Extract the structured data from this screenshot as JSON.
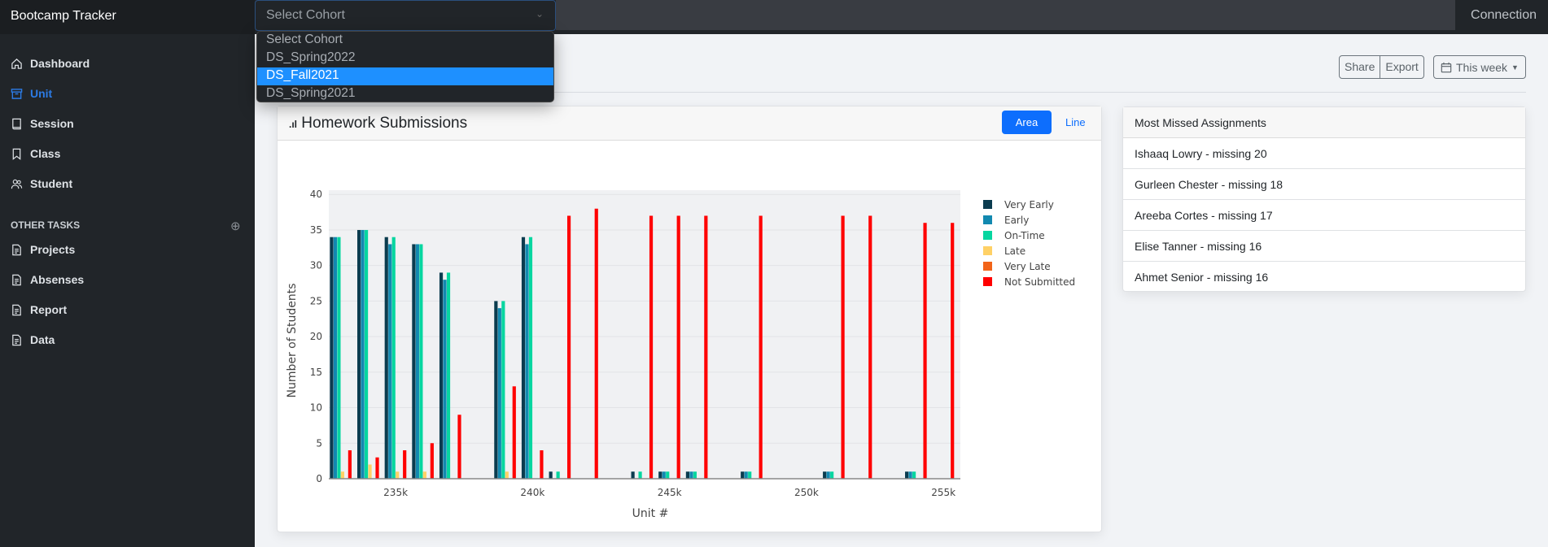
{
  "app": {
    "title": "Bootcamp Tracker",
    "connection_label": "Connection"
  },
  "cohort_select": {
    "value": "Select Cohort",
    "options": [
      "Select Cohort",
      "DS_Spring2022",
      "DS_Fall2021",
      "DS_Spring2021"
    ],
    "highlighted": "DS_Fall2021"
  },
  "sidebar": {
    "items": [
      {
        "label": "Dashboard",
        "icon": "house-icon"
      },
      {
        "label": "Unit",
        "icon": "archive-icon",
        "active": true
      },
      {
        "label": "Session",
        "icon": "book-icon"
      },
      {
        "label": "Class",
        "icon": "bookmark-icon"
      },
      {
        "label": "Student",
        "icon": "people-icon"
      }
    ],
    "section_title": "OTHER TASKS",
    "tasks": [
      {
        "label": "Projects",
        "icon": "file-text-icon"
      },
      {
        "label": "Absenses",
        "icon": "file-text-icon"
      },
      {
        "label": "Report",
        "icon": "file-text-icon"
      },
      {
        "label": "Data",
        "icon": "file-text-icon"
      }
    ]
  },
  "toolbar": {
    "share_label": "Share",
    "export_label": "Export",
    "range_label": "This week"
  },
  "chart_card": {
    "title": "Homework Submissions",
    "area_label": "Area",
    "line_label": "Line",
    "active_mode": "Area"
  },
  "missed": {
    "title": "Most Missed Assignments",
    "items": [
      "Ishaaq Lowry - missing 20",
      "Gurleen Chester - missing 18",
      "Areeba Cortes - missing 17",
      "Elise Tanner - missing 16",
      "Ahmet Senior - missing 16"
    ]
  },
  "chart_data": {
    "type": "bar",
    "mode": "grouped",
    "xlabel": "Unit #",
    "ylabel": "Number of Students",
    "x": [
      233000,
      234000,
      235000,
      236000,
      237000,
      239000,
      240000,
      241000,
      242000,
      244000,
      245000,
      246000,
      248000,
      251000,
      252000,
      254000,
      255000
    ],
    "xlim": [
      232560,
      255620
    ],
    "ylim": [
      0,
      40.6
    ],
    "x_ticks": [
      235000,
      240000,
      245000,
      250000,
      255000
    ],
    "x_tick_labels": [
      "235k",
      "240k",
      "245k",
      "250k",
      "255k"
    ],
    "y_ticks": [
      0,
      5,
      10,
      15,
      20,
      25,
      30,
      35,
      40
    ],
    "y_tick_labels": [
      "0",
      "5",
      "10",
      "15",
      "20",
      "25",
      "30",
      "35",
      "40"
    ],
    "grid": true,
    "legend_position": "right",
    "series": [
      {
        "name": "Very Early",
        "color": "#0b3c4f",
        "values": [
          34,
          35,
          34,
          33,
          29,
          25,
          34,
          1,
          0,
          1,
          1,
          1,
          1,
          1,
          0,
          1,
          0
        ]
      },
      {
        "name": "Early",
        "color": "#1289b0",
        "values": [
          34,
          35,
          33,
          33,
          28,
          24,
          33,
          0,
          0,
          0,
          1,
          1,
          1,
          1,
          0,
          1,
          0
        ]
      },
      {
        "name": "On-Time",
        "color": "#06d6a0",
        "values": [
          34,
          35,
          34,
          33,
          29,
          25,
          34,
          1,
          0,
          1,
          1,
          1,
          1,
          1,
          0,
          1,
          0
        ]
      },
      {
        "name": "Late",
        "color": "#ffd166",
        "values": [
          1,
          2,
          1,
          1,
          0,
          1,
          0,
          0,
          0,
          0,
          0,
          0,
          0,
          0,
          0,
          0,
          0
        ]
      },
      {
        "name": "Very Late",
        "color": "#f26419",
        "values": [
          0,
          0,
          0,
          0,
          0,
          0,
          0,
          0,
          0,
          0,
          0,
          0,
          0,
          0,
          0,
          0,
          0
        ]
      },
      {
        "name": "Not Submitted",
        "color": "#ff0000",
        "values": [
          4,
          3,
          4,
          5,
          9,
          13,
          4,
          37,
          38,
          37,
          37,
          37,
          37,
          37,
          37,
          36,
          36
        ]
      }
    ]
  }
}
